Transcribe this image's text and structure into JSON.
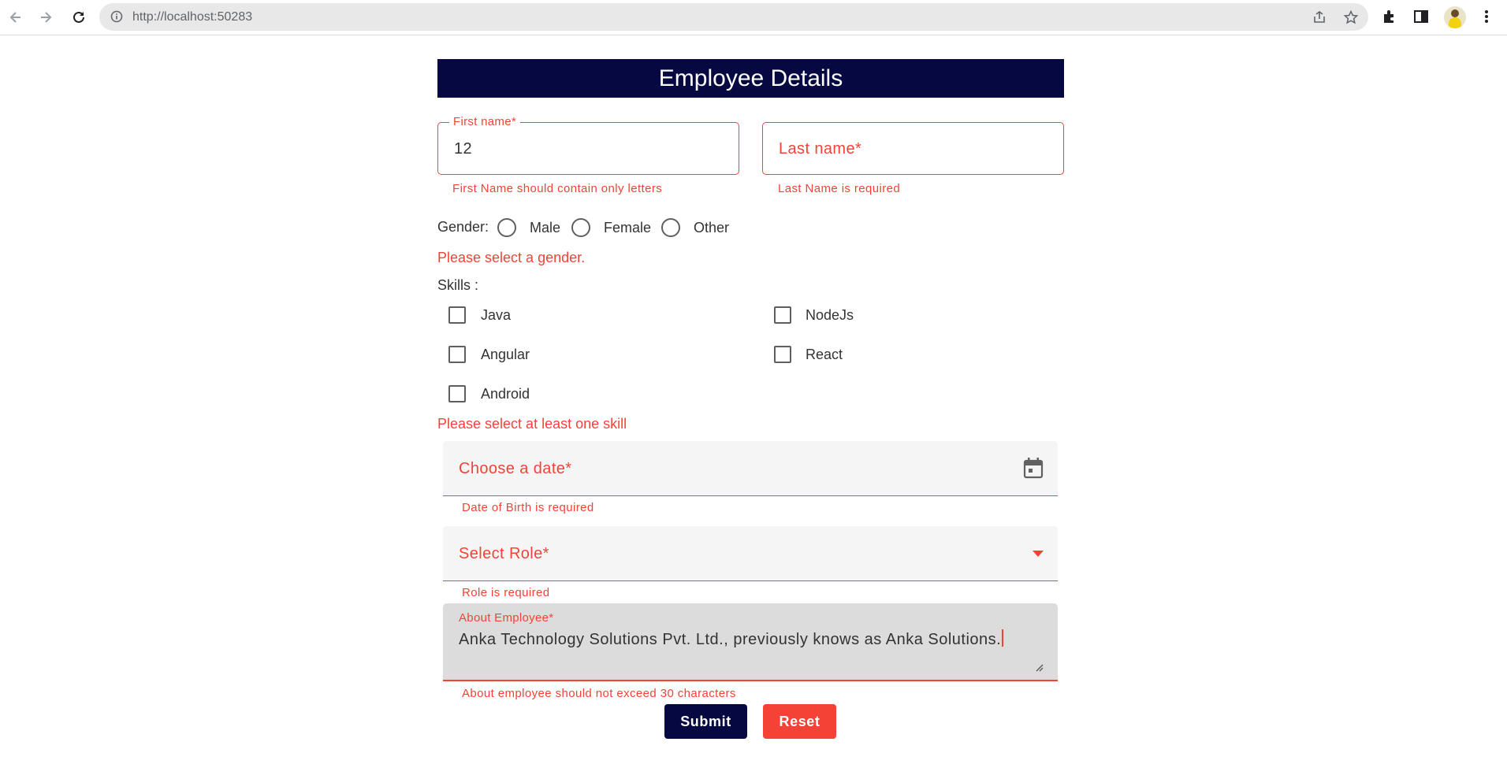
{
  "browser": {
    "url": "http://localhost:50283",
    "back_icon": "arrow-left-icon",
    "forward_icon": "arrow-right-icon",
    "reload_icon": "reload-icon"
  },
  "form": {
    "title": "Employee Details",
    "first_name": {
      "label": "First name*",
      "value": "12",
      "error": "First Name should contain only letters"
    },
    "last_name": {
      "placeholder": "Last name*",
      "error": "Last Name is required"
    },
    "gender": {
      "label": "Gender:",
      "options": [
        "Male",
        "Female",
        "Other"
      ],
      "error": "Please select a gender."
    },
    "skills": {
      "label": "Skills :",
      "options": [
        "Java",
        "NodeJs",
        "Angular",
        "React",
        "Android"
      ],
      "error": "Please select at least one skill"
    },
    "dob": {
      "placeholder": "Choose a date*",
      "error": "Date of Birth is required"
    },
    "role": {
      "placeholder": "Select Role*",
      "error": "Role is required"
    },
    "about": {
      "label": "About Employee*",
      "value": "Anka Technology Solutions Pvt. Ltd., previously knows as Anka Solutions.",
      "error": "About employee should not exceed 30 characters"
    },
    "submit_label": "Submit",
    "reset_label": "Reset"
  },
  "colors": {
    "header_bg": "#060841",
    "error": "#f44336",
    "submit_bg": "#060841",
    "reset_bg": "#f44336"
  }
}
